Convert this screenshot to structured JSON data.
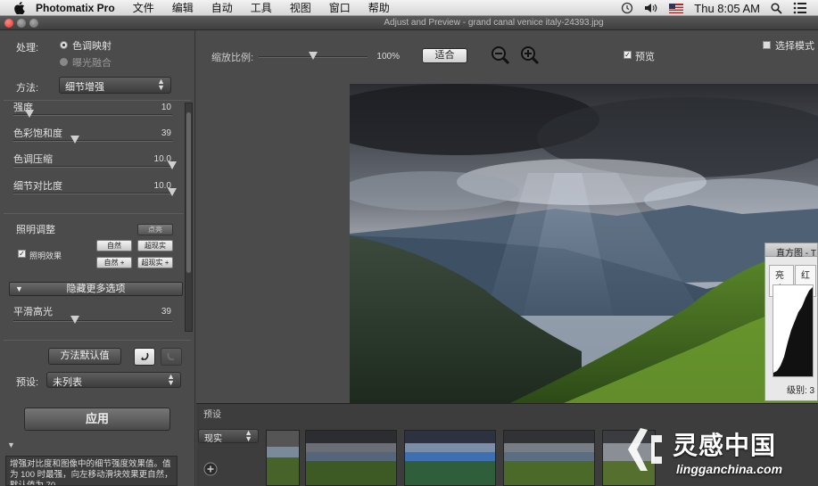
{
  "menubar": {
    "app_name": "Photomatix Pro",
    "items": [
      "文件",
      "编辑",
      "自动",
      "工具",
      "视图",
      "窗口",
      "帮助"
    ],
    "clock": "Thu 8:05 AM"
  },
  "window": {
    "title": "Adjust and Preview - grand canal venice italy-24393.jpg"
  },
  "left_panel": {
    "process_label": "处理:",
    "process_options": [
      "色调映射",
      "曝光融合"
    ],
    "method_label": "方法:",
    "method_value": "细节增强",
    "sliders": [
      {
        "label": "强度",
        "value": "10",
        "fraction": 0.1
      },
      {
        "label": "色彩饱和度",
        "value": "39",
        "fraction": 0.39
      },
      {
        "label": "色调压缩",
        "value": "10.0",
        "fraction": 1.0
      },
      {
        "label": "细节对比度",
        "value": "10.0",
        "fraction": 1.0
      }
    ],
    "lighting_label": "照明调整",
    "lighting_buttons": [
      "点亮",
      "自然",
      "超现实",
      "自然",
      "超现实"
    ],
    "lighting_effect_label": "照明效果",
    "more_options": "隐藏更多选项",
    "smooth_highlights": {
      "label": "平滑高光",
      "value": "39",
      "fraction": 0.39
    },
    "default_button": "方法默认值",
    "preset_label": "预设:",
    "preset_value": "未列表",
    "apply_button": "应用",
    "description": "增强对比度和图像中的细节强度效果值。值为 100 时最强，向左移动滑块效果更自然，默认值为 70。"
  },
  "toolbar": {
    "zoom_label": "缩放比例:",
    "zoom_value": "100%",
    "fit_button": "适合",
    "zoom_fraction": 0.5,
    "preview_label": "预览",
    "select_mode_label": "选择模式"
  },
  "histogram": {
    "title": "直方图 - T",
    "tabs": [
      "亮度",
      "红"
    ],
    "level_label": "级别: 3"
  },
  "presets_panel": {
    "label": "预设",
    "dropdown_value": "现实"
  },
  "watermark": {
    "brand": "灵感中国",
    "url": "lingganchina.com"
  },
  "colors": {
    "accent": "#4a90d9",
    "panel_bg": "#4b4b4b"
  }
}
